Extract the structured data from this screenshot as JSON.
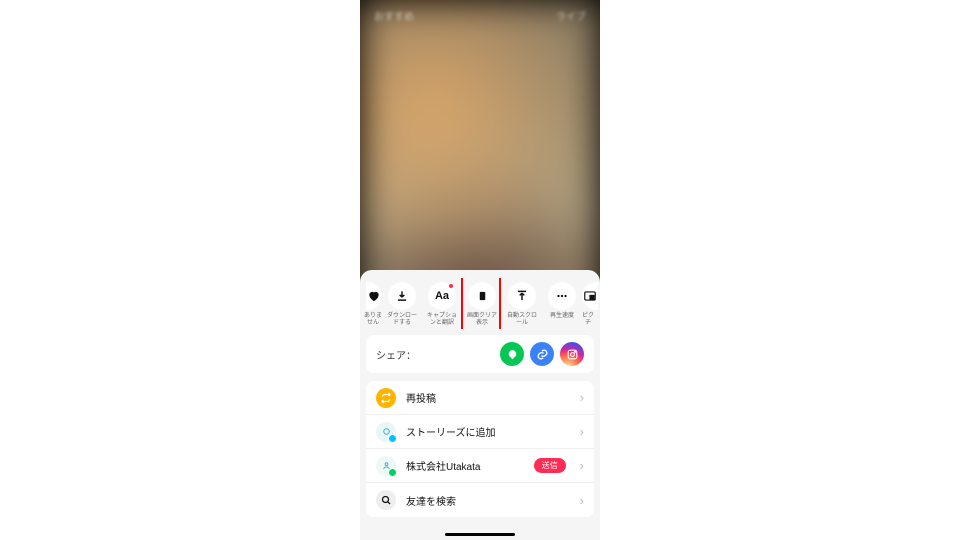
{
  "top": {
    "left": "おすすめ",
    "right": "ライブ"
  },
  "actions": [
    {
      "icon": "heart",
      "label": "ありま\nせん",
      "cut": "left"
    },
    {
      "icon": "download",
      "label": "ダウンロー\nドする"
    },
    {
      "icon": "Aa",
      "label": "キャプショ\nンと翻訳",
      "badge": true
    },
    {
      "icon": "phone",
      "label": "画面クリア\n表示",
      "highlight": true
    },
    {
      "icon": "upload",
      "label": "自動スクロ\nール"
    },
    {
      "icon": "dots",
      "label": "再生速度"
    },
    {
      "icon": "pip",
      "label": "ピク\nチ",
      "cut": "right"
    }
  ],
  "share": {
    "label": "シェア：",
    "targets": [
      "line",
      "link",
      "instagram"
    ]
  },
  "menu": [
    {
      "icon": "repost",
      "label": "再投稿"
    },
    {
      "icon": "stories",
      "label": "ストーリーズに追加"
    },
    {
      "icon": "user",
      "label": "株式会社Utakata",
      "send": "送信"
    },
    {
      "icon": "search",
      "label": "友達を検索"
    }
  ]
}
